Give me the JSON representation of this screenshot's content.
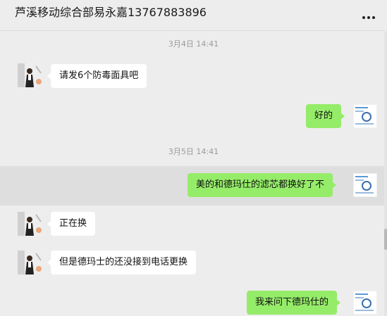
{
  "header": {
    "title": "芦溪移动综合部易永嘉13767883896",
    "menu_icon": "more-dots-icon"
  },
  "messages": [
    {
      "kind": "timestamp",
      "text": "3月4日 14:41"
    },
    {
      "kind": "message",
      "side": "in",
      "text": "请发6个防毒面具吧"
    },
    {
      "kind": "message",
      "side": "out",
      "text": "好的"
    },
    {
      "kind": "timestamp",
      "text": "3月5日 14:41"
    },
    {
      "kind": "message",
      "side": "out",
      "text": "美的和德玛仕的滤芯都换好了不",
      "highlighted": true
    },
    {
      "kind": "message",
      "side": "in",
      "text": "正在换"
    },
    {
      "kind": "message",
      "side": "in",
      "text": "但是德玛士的还没接到电话更换"
    },
    {
      "kind": "message",
      "side": "out",
      "text": "我来问下德玛仕的"
    }
  ],
  "colors": {
    "outgoing_bubble": "#95ec69",
    "incoming_bubble": "#ffffff",
    "background": "#ededed"
  }
}
